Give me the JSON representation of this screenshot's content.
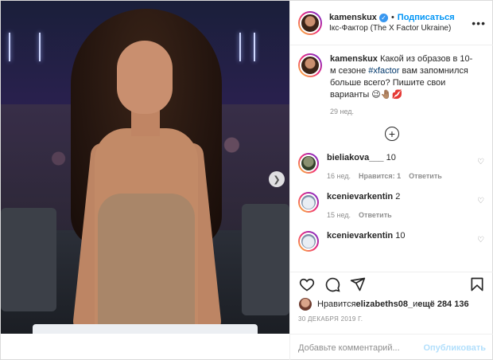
{
  "header": {
    "username": "kamenskux",
    "follow_label": "Подписаться",
    "location": "Ікс-Фактор (The X Factor Ukraine)"
  },
  "caption": {
    "username": "kamenskux",
    "text_before_tag": "Какой из образов в 10-м сезоне ",
    "hashtag": "#xfactor",
    "text_after_tag": " вам запомнился больше всего? Пишите свои варианты 😉🤚🏽💋",
    "time": "29 нед."
  },
  "comments": [
    {
      "username": "bieliakova___",
      "text": "10",
      "time": "16 нед.",
      "likes": "Нравится: 1",
      "reply": "Ответить"
    },
    {
      "username": "kcenievarkentin",
      "text": "2",
      "time": "15 нед.",
      "reply": "Ответить"
    },
    {
      "username": "kcenievarkentin",
      "text": "10"
    }
  ],
  "likes": {
    "prefix": "Нравится ",
    "user": "elizabeths08_",
    "middle": " и ",
    "others": "ещё 284 136"
  },
  "date": "30 ДЕКАБРЯ 2019 Г.",
  "add_comment": {
    "placeholder": "Добавьте комментарий...",
    "publish_label": "Опубликовать"
  },
  "icons": {
    "like": "heart-icon",
    "comment": "comment-icon",
    "share": "paper-plane-icon",
    "save": "bookmark-icon",
    "more": "more-options-icon",
    "load_more": "plus-circle-icon",
    "next": "chevron-right-icon",
    "verified": "verified-badge-icon"
  },
  "colors": {
    "accent": "#0095f6",
    "verified": "#3897f0",
    "muted": "#8e8e8e",
    "publish_disabled": "#b2dffc"
  }
}
